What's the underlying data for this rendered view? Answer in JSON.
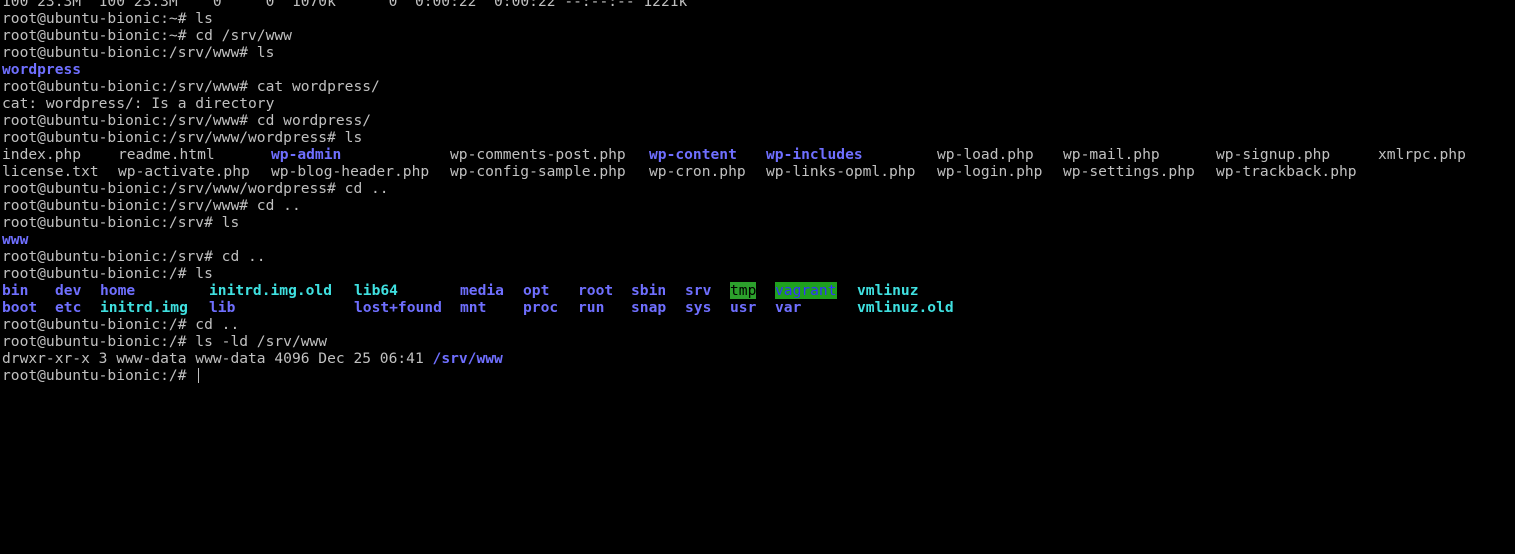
{
  "terminal": {
    "lines": [
      {
        "text": "100 23.3M  100 23.3M    0     0  1070k      0  0:00:22  0:00:22 --:--:-- 1221k"
      },
      {
        "text": "root@ubuntu-bionic:~# ls"
      },
      {
        "text": "root@ubuntu-bionic:~# cd /srv/www"
      },
      {
        "text": "root@ubuntu-bionic:/srv/www# ls"
      },
      {
        "text": "wordpress"
      },
      {
        "text": "root@ubuntu-bionic:/srv/www# cat wordpress/"
      },
      {
        "text": "cat: wordpress/: Is a directory"
      },
      {
        "text": "root@ubuntu-bionic:/srv/www# cd wordpress/"
      },
      {
        "text": "root@ubuntu-bionic:/srv/www/wordpress# ls"
      },
      {
        "listing": [
          "index.php",
          "readme.html",
          "wp-admin",
          "wp-comments-post.php",
          "wp-content",
          "wp-includes",
          "wp-load.php",
          "wp-mail.php",
          "wp-signup.php",
          "xmlrpc.php"
        ]
      },
      {
        "listing": [
          "license.txt",
          "wp-activate.php",
          "wp-blog-header.php",
          "wp-config-sample.php",
          "wp-cron.php",
          "wp-links-opml.php",
          "wp-login.php",
          "wp-settings.php",
          "wp-trackback.php"
        ]
      },
      {
        "text": "root@ubuntu-bionic:/srv/www/wordpress# cd .."
      },
      {
        "text": "root@ubuntu-bionic:/srv/www# cd .."
      },
      {
        "text": "root@ubuntu-bionic:/srv# ls"
      },
      {
        "text": "www"
      },
      {
        "text": "root@ubuntu-bionic:/srv# cd .."
      },
      {
        "text": "root@ubuntu-bionic:/# ls"
      },
      {
        "listing": [
          "bin",
          "dev",
          "home",
          "initrd.img.old",
          "lib64",
          "media",
          "opt",
          "root",
          "sbin",
          "srv",
          "tmp",
          "vagrant",
          "vmlinuz"
        ]
      },
      {
        "listing": [
          "boot",
          "etc",
          "initrd.img",
          "lib",
          "lost+found",
          "mnt",
          "proc",
          "run",
          "snap",
          "sys",
          "usr",
          "var",
          "vmlinuz.old"
        ]
      },
      {
        "text": "root@ubuntu-bionic:/# cd .."
      },
      {
        "text": "root@ubuntu-bionic:/# ls -ld /srv/www"
      },
      {
        "text": "drwxr-xr-x 3 www-data www-data 4096 Dec 25 06:41 ",
        "path": "/srv/www"
      },
      {
        "text": "root@ubuntu-bionic:/# "
      }
    ]
  },
  "colors": {
    "background": "#000000",
    "foreground": "#c0c0c0",
    "directory": "#6f6fff",
    "symlink": "#3fe0e0",
    "sticky_bg": "#2ca02c"
  }
}
